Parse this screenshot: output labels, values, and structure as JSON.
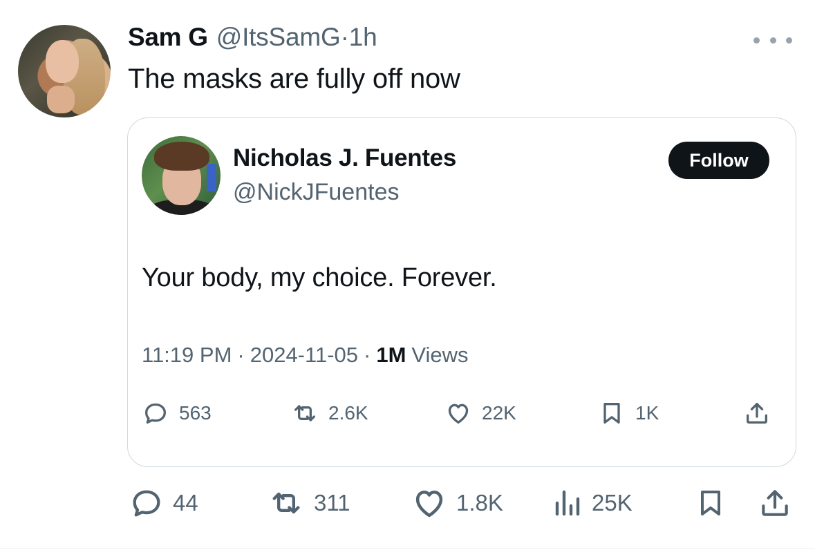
{
  "tweet": {
    "author_name": "Sam G",
    "author_handle": "@ItsSamG",
    "separator": "·",
    "time_ago": "1h",
    "text": "The masks are fully off now",
    "more_icon": "more-horizontal-icon",
    "actions": {
      "replies": "44",
      "reposts": "311",
      "likes": "1.8K",
      "views": "25K"
    }
  },
  "quoted_tweet": {
    "author_name": "Nicholas J. Fuentes",
    "author_handle": "@NickJFuentes",
    "follow_label": "Follow",
    "text": "Your body, my choice. Forever.",
    "time": "11:19 PM",
    "separator": "·",
    "date": "2024-11-05",
    "views_count": "1M",
    "views_label": "Views",
    "actions": {
      "replies": "563",
      "reposts": "2.6K",
      "likes": "22K",
      "bookmarks": "1K"
    }
  },
  "colors": {
    "text_primary": "#0f1419",
    "text_secondary": "#536471",
    "border": "#cfd9de",
    "follow_bg": "#0f1419"
  }
}
